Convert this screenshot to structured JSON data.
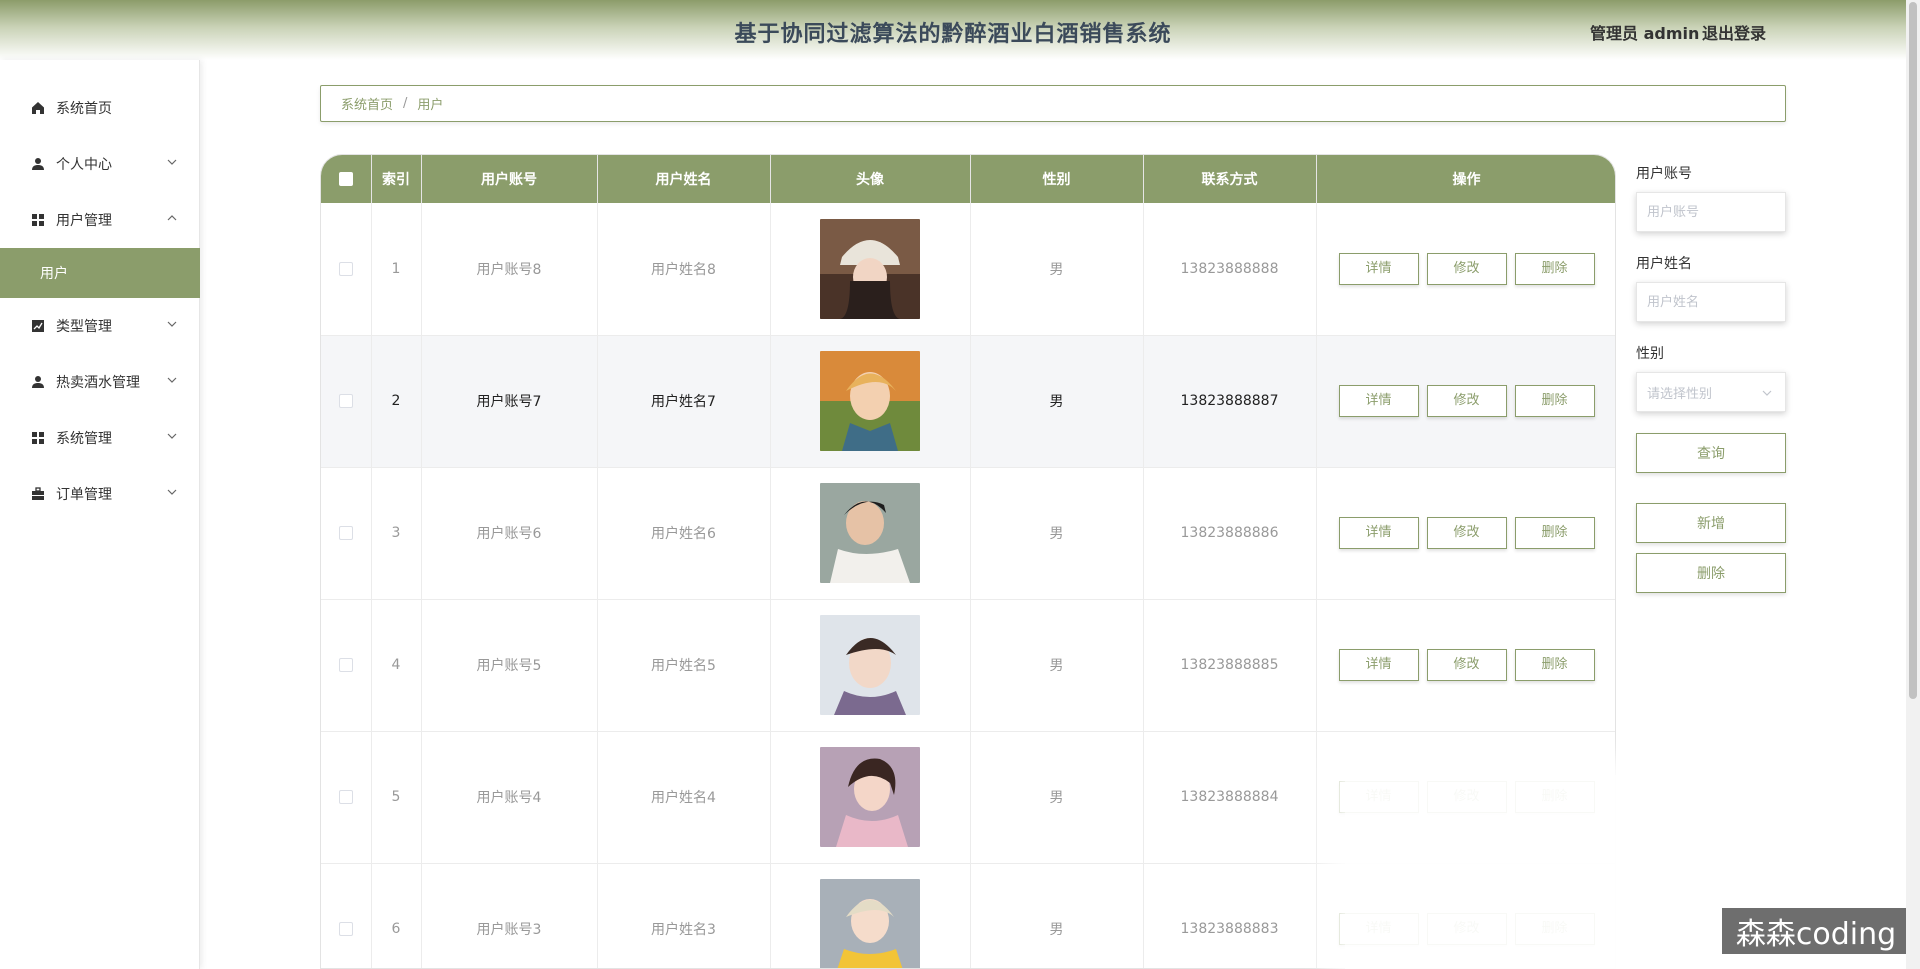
{
  "header": {
    "title": "基于协同过滤算法的黔醉酒业白酒销售系统",
    "admin": "管理员 admin",
    "logout": "退出登录"
  },
  "sidebar": {
    "items": [
      {
        "label": "系统首页",
        "icon": "home-icon"
      },
      {
        "label": "个人中心",
        "icon": "user-icon"
      },
      {
        "label": "用户管理",
        "icon": "grid-icon"
      },
      {
        "label": "类型管理",
        "icon": "chart-icon"
      },
      {
        "label": "热卖酒水管理",
        "icon": "user-icon"
      },
      {
        "label": "系统管理",
        "icon": "grid-icon"
      },
      {
        "label": "订单管理",
        "icon": "briefcase-icon"
      }
    ],
    "active_sub": "用户"
  },
  "breadcrumb": {
    "home": "系统首页",
    "separator": "/",
    "current": "用户"
  },
  "table": {
    "headers": [
      "索引",
      "用户账号",
      "用户姓名",
      "头像",
      "性别",
      "联系方式",
      "操作"
    ],
    "rows": [
      {
        "index": "1",
        "account": "用户账号8",
        "name": "用户姓名8",
        "gender": "男",
        "phone": "13823888888"
      },
      {
        "index": "2",
        "account": "用户账号7",
        "name": "用户姓名7",
        "gender": "男",
        "phone": "13823888887"
      },
      {
        "index": "3",
        "account": "用户账号6",
        "name": "用户姓名6",
        "gender": "男",
        "phone": "13823888886"
      },
      {
        "index": "4",
        "account": "用户账号5",
        "name": "用户姓名5",
        "gender": "男",
        "phone": "13823888885"
      },
      {
        "index": "5",
        "account": "用户账号4",
        "name": "用户姓名4",
        "gender": "男",
        "phone": "13823888884"
      },
      {
        "index": "6",
        "account": "用户账号3",
        "name": "用户姓名3",
        "gender": "男",
        "phone": "13823888883"
      }
    ],
    "actions": {
      "detail": "详情",
      "edit": "修改",
      "delete": "删除"
    }
  },
  "search": {
    "account_label": "用户账号",
    "account_placeholder": "用户账号",
    "name_label": "用户姓名",
    "name_placeholder": "用户姓名",
    "gender_label": "性别",
    "gender_placeholder": "请选择性别",
    "query": "查询",
    "add": "新增",
    "delete": "删除"
  },
  "watermark": "森森coding",
  "colors": {
    "accent": "#8b9d6b",
    "title": "#3b4a5a"
  }
}
